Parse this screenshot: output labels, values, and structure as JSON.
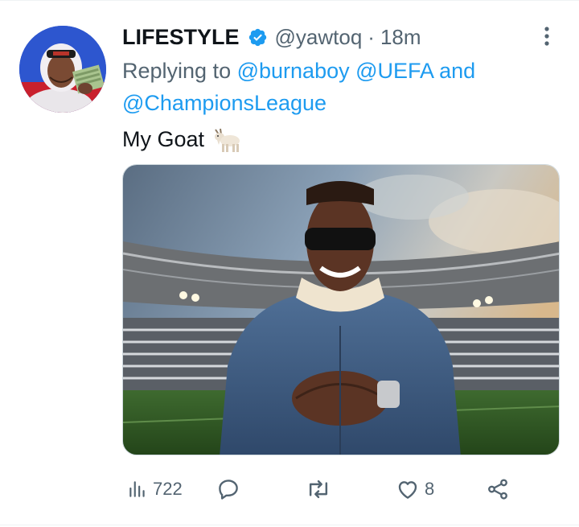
{
  "tweet": {
    "author_name": "LIFESTYLE",
    "handle": "@yawtoq",
    "separator": "·",
    "time": "18m",
    "replying_prefix": "Replying to",
    "mentions": [
      "@burnaboy",
      "@UEFA",
      "@ChampionsLeague"
    ],
    "mention_joiner": "and",
    "text": "My Goat",
    "emoji": "goat-emoji"
  },
  "actions": {
    "views": "722",
    "replies": "",
    "retweets": "",
    "likes": "8"
  },
  "icons": {
    "verified": "verified-badge-icon",
    "more": "more-options-icon",
    "views": "views-chart-icon",
    "reply": "reply-icon",
    "retweet": "retweet-icon",
    "like": "heart-icon",
    "share": "share-icon"
  },
  "colors": {
    "accent": "#1d9bf0",
    "secondary_text": "#536471",
    "primary_text": "#0f1419"
  }
}
